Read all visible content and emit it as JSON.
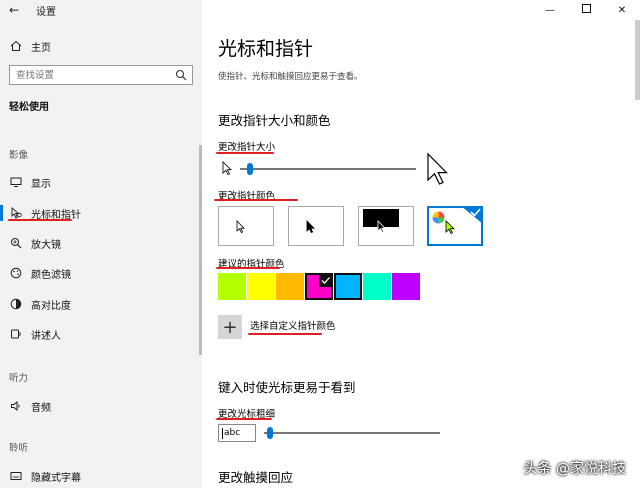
{
  "window": {
    "title": "设置"
  },
  "sidebar": {
    "home_label": "主页",
    "search_placeholder": "查找设置",
    "section_title": "轻松使用",
    "groups": {
      "vision": "影像",
      "hearing": "听力",
      "interaction": "聆听"
    },
    "items": {
      "display": "显示",
      "cursor": "光标和指针",
      "magnifier": "放大镜",
      "color_filter": "颜色滤镜",
      "high_contrast": "高对比度",
      "narrator": "讲述人",
      "audio": "音频",
      "captions": "隐藏式字幕"
    }
  },
  "main": {
    "title": "光标和指针",
    "description": "使指针、光标和触摸回应更易于查看。",
    "section_size_color": "更改指针大小和颜色",
    "size_label": "更改指针大小",
    "size_value": 0.04,
    "color_label": "更改指针颜色",
    "suggested_label": "建议的指针颜色",
    "custom_label": "选择自定义指针颜色",
    "section_cursor": "键入时使光标更易于看到",
    "thickness_label": "更改光标粗细",
    "thickness_preview": "abc",
    "thickness_value": 0.02,
    "section_touch": "更改触摸回应"
  },
  "colors": {
    "accent": "#0078d7",
    "swatches": [
      "#b4ff00",
      "#ffff00",
      "#ffb900",
      "#ff00c8",
      "#00b4ff",
      "#00ffc8",
      "#be00ff"
    ]
  },
  "watermark": "头条 @家悦科技"
}
